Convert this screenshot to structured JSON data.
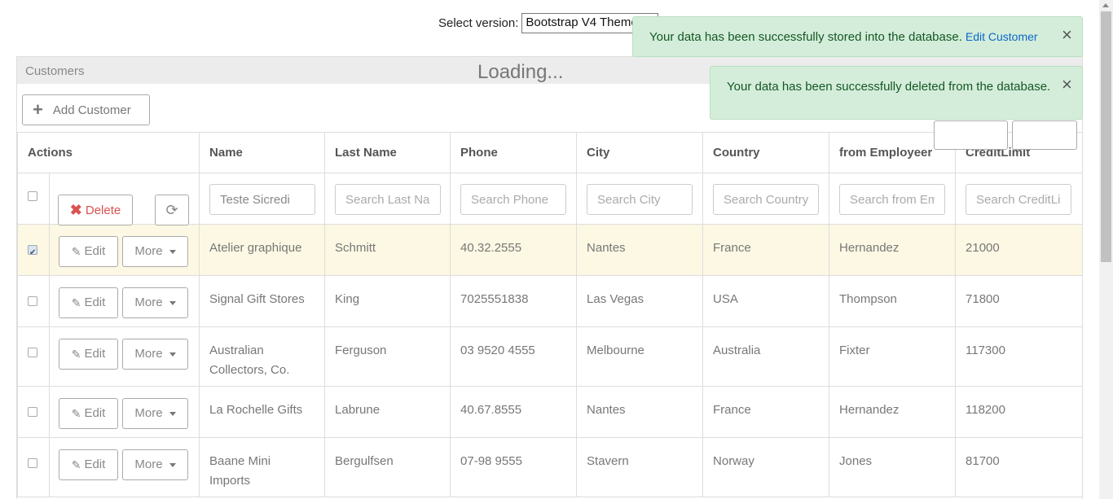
{
  "version": {
    "label": "Select version:",
    "selected": "Bootstrap V4 Theme"
  },
  "crud": {
    "title": "Customers",
    "loading": "Loading...",
    "add_button": "Add Customer",
    "columns": [
      "Actions",
      "Name",
      "Last Name",
      "Phone",
      "City",
      "Country",
      "from Employeer",
      "CreditLimit"
    ],
    "filters": {
      "delete_label": "Delete",
      "name_value": "Teste Sicredi",
      "lastname_placeholder": "Search Last Name",
      "phone_placeholder": "Search Phone",
      "city_placeholder": "Search City",
      "country_placeholder": "Search Country",
      "employee_placeholder": "Search from Employeer",
      "credit_placeholder": "Search CreditLimit"
    },
    "edit_label": "Edit",
    "more_label": "More",
    "rows": [
      {
        "name": "Atelier graphique",
        "last_name": "Schmitt",
        "phone": "40.32.2555",
        "city": "Nantes",
        "country": "France",
        "employee": "Hernandez",
        "credit": "21000",
        "checked": true
      },
      {
        "name": "Signal Gift Stores",
        "last_name": "King",
        "phone": "7025551838",
        "city": "Las Vegas",
        "country": "USA",
        "employee": "Thompson",
        "credit": "71800",
        "checked": false
      },
      {
        "name": "Australian Collectors, Co.",
        "last_name": "Ferguson",
        "phone": "03 9520 4555",
        "city": "Melbourne",
        "country": "Australia",
        "employee": "Fixter",
        "credit": "117300",
        "checked": false
      },
      {
        "name": "La Rochelle Gifts",
        "last_name": "Labrune",
        "phone": "40.67.8555",
        "city": "Nantes",
        "country": "France",
        "employee": "Hernandez",
        "credit": "118200",
        "checked": false
      },
      {
        "name": "Baane Mini Imports",
        "last_name": "Bergulfsen",
        "phone": "07-98 9555",
        "city": "Stavern",
        "country": "Norway",
        "employee": "Jones",
        "credit": "81700",
        "checked": false
      }
    ]
  },
  "notifications": {
    "stored": {
      "message": "Your data has been successfully stored into the database.",
      "link": "Edit Customer"
    },
    "deleted": {
      "message": "Your data has been successfully deleted from the database."
    }
  },
  "colors": {
    "success_bg": "#d4edda",
    "selected_row": "#fcf8e3",
    "delete": "#d9534f",
    "link": "#0b67c9"
  }
}
